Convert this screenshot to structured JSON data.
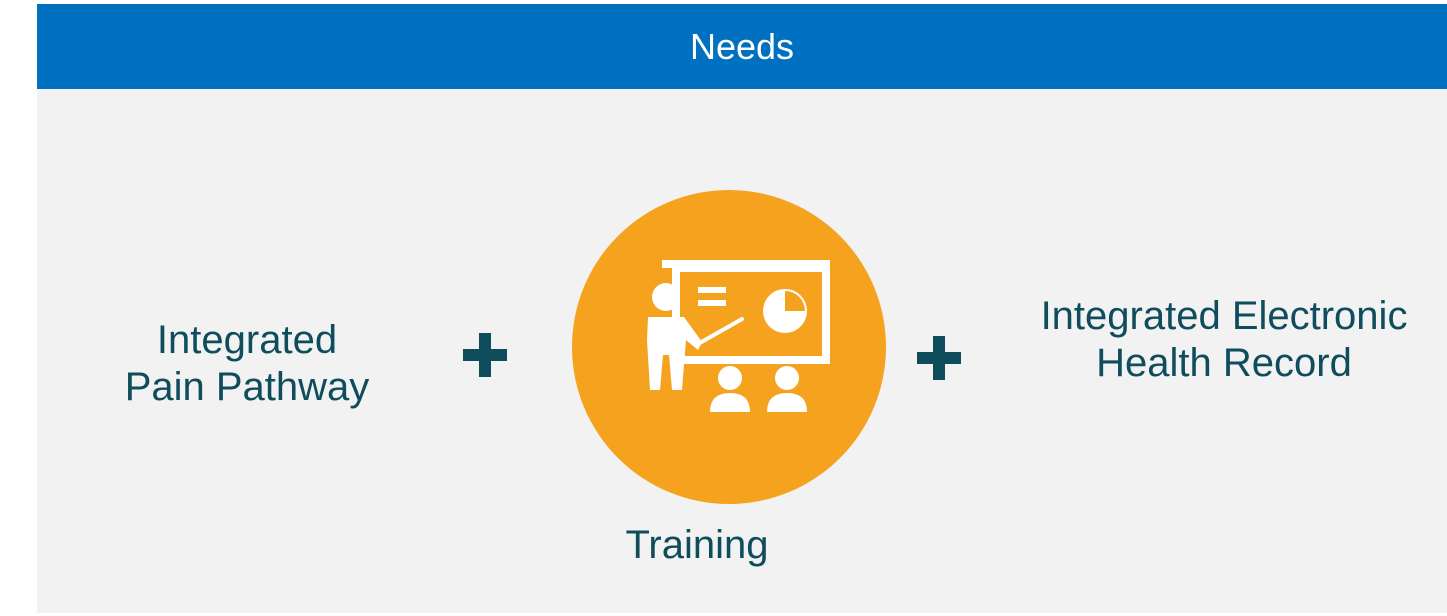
{
  "header": {
    "title": "Needs",
    "background": "#0070c0",
    "text_color": "#ffffff"
  },
  "items": {
    "left": {
      "line1": "Integrated",
      "line2": "Pain Pathway"
    },
    "center": {
      "label": "Training",
      "icon": "presentation-training-icon",
      "circle_color": "#f5a21f"
    },
    "right": {
      "line1": "Integrated Electronic",
      "line2": "Health Record"
    }
  },
  "connectors": {
    "icon": "plus-icon",
    "color": "#0f4c5c"
  },
  "panel_background": "#f2f2f2"
}
